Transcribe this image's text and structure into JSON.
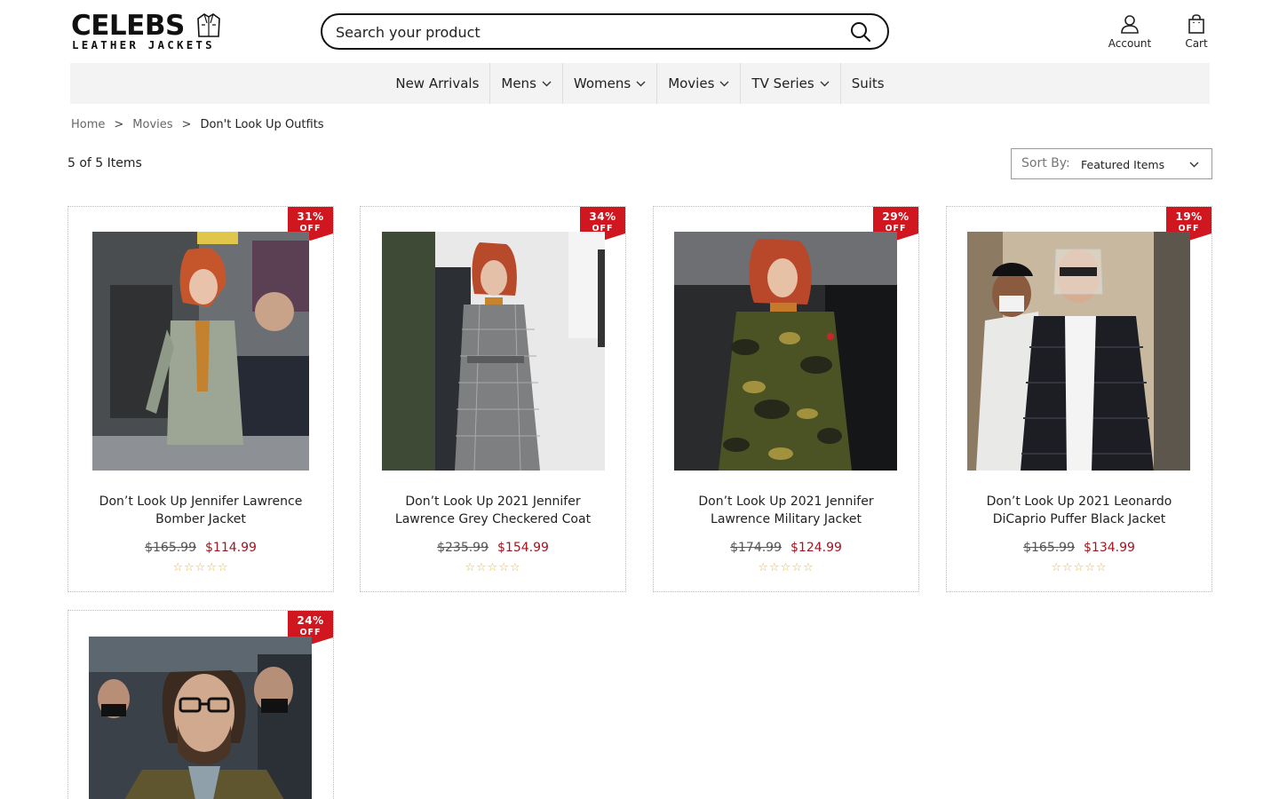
{
  "brand": {
    "name": "CELEBS",
    "tagline": "LEATHER JACKETS"
  },
  "search": {
    "placeholder": "Search your product"
  },
  "header": {
    "account_label": "Account",
    "cart_label": "Cart"
  },
  "nav": {
    "items": [
      {
        "label": "New Arrivals",
        "dropdown": false
      },
      {
        "label": "Mens",
        "dropdown": true
      },
      {
        "label": "Womens",
        "dropdown": true
      },
      {
        "label": "Movies",
        "dropdown": true
      },
      {
        "label": "TV Series",
        "dropdown": true
      },
      {
        "label": "Suits",
        "dropdown": false
      }
    ]
  },
  "breadcrumb": {
    "home": "Home",
    "sep": ">",
    "category": "Movies",
    "current": "Don't Look Up Outfits"
  },
  "listing": {
    "count": "5 of 5 Items",
    "sort_label": "Sort By:",
    "sort_value": "Featured Items"
  },
  "products": [
    {
      "discount": "31%",
      "off": "OFF",
      "title": "Don’t Look Up Jennifer Lawrence Bomber Jacket",
      "old_price": "$165.99",
      "new_price": "$114.99",
      "stars": "☆☆☆☆☆"
    },
    {
      "discount": "34%",
      "off": "OFF",
      "title": "Don’t Look Up 2021 Jennifer Lawrence Grey Checkered Coat",
      "old_price": "$235.99",
      "new_price": "$154.99",
      "stars": "☆☆☆☆☆"
    },
    {
      "discount": "29%",
      "off": "OFF",
      "title": "Don’t Look Up 2021 Jennifer Lawrence Military Jacket",
      "old_price": "$174.99",
      "new_price": "$124.99",
      "stars": "☆☆☆☆☆"
    },
    {
      "discount": "19%",
      "off": "OFF",
      "title": "Don’t Look Up 2021 Leonardo DiCaprio Puffer Black Jacket",
      "old_price": "$165.99",
      "new_price": "$134.99",
      "stars": "☆☆☆☆☆"
    },
    {
      "discount": "24%",
      "off": "OFF",
      "title": "",
      "old_price": "",
      "new_price": "",
      "stars": ""
    }
  ],
  "colors": {
    "badge": "#d0161e",
    "sale_price": "#a21521",
    "nav_bg": "#f3f3f3",
    "star": "#e8b64a"
  }
}
